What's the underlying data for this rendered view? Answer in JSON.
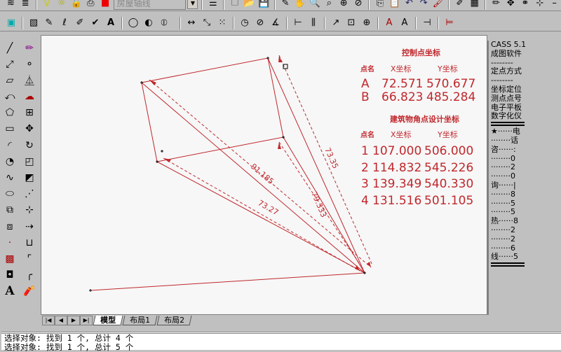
{
  "toolbar": {
    "layer_name": "房屋轴线"
  },
  "control_table": {
    "title": "控制点坐标",
    "headers": [
      "点名",
      "X坐标",
      "Y坐标"
    ],
    "rows": [
      [
        "A",
        "72.571",
        "570.677"
      ],
      [
        "B",
        "66.823",
        "485.284"
      ]
    ]
  },
  "design_table": {
    "title": "建筑物角点设计坐标",
    "headers": [
      "点名",
      "X坐标",
      "Y坐标"
    ],
    "rows": [
      [
        "1",
        "107.000",
        "506.000"
      ],
      [
        "2",
        "114.832",
        "545.226"
      ],
      [
        "3",
        "139.349",
        "540.330"
      ],
      [
        "4",
        "131.516",
        "501.105"
      ]
    ]
  },
  "dimensions": [
    "91.185",
    "73.27",
    "79.333",
    "73.35"
  ],
  "right_panel": {
    "lines1": [
      "CASS 5.1",
      "成图软件",
      "--------",
      "定点方式",
      "--------",
      "坐标定位",
      "测点点号",
      "电子平板",
      "数字化仪"
    ],
    "lines2": [
      "★······电",
      "········话",
      "咨······:",
      "········0",
      "········2",
      "········0",
      "询······|",
      "········8",
      "········5",
      "········5",
      "热······8",
      "········2",
      "········2",
      "········6",
      "线······5"
    ]
  },
  "tabs": [
    "模型",
    "布局1",
    "布局2"
  ],
  "command_lines": [
    "选择对象: 找到 1 个, 总计 4 个",
    "选择对象: 找到 1 个, 总计 5 个"
  ],
  "colors": {
    "drawing": "#c0282d",
    "canvas": "#f7f7f7"
  }
}
